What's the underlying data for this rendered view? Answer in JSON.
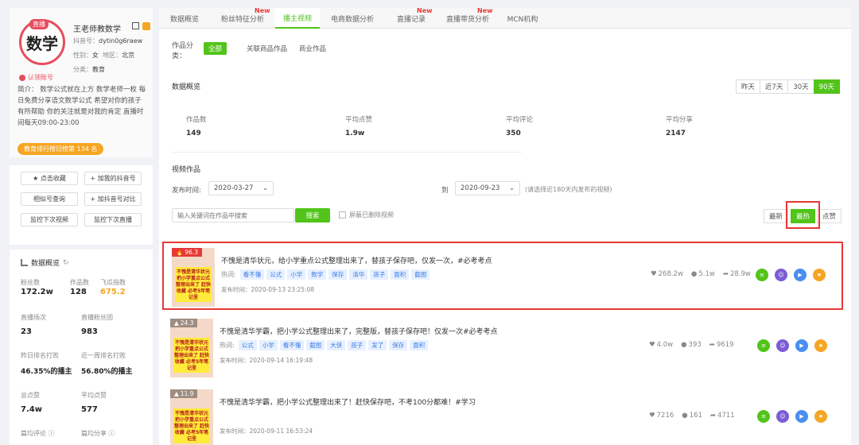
{
  "profile": {
    "live_tag": "直播",
    "avatar_text": "数学",
    "name": "王老师教数学",
    "douyin_id_label": "抖音号：",
    "douyin_id": "dytin0g6raew",
    "gender_label": "性别：",
    "gender": "女",
    "region_label": "地区：",
    "region": "北京",
    "category_label": "分类：",
    "category": "教育",
    "verified": "认领账号",
    "bio": "简介：  数学公式就在上方        数学老师一枚 每日免费分享语文数学公式 希望对你的孩子有所帮助 你的关注就是对我的肯定 直播时间每天09:00-23:00",
    "rank": "教育排行榜日榜第 134 名"
  },
  "actions": {
    "favorite": "★ 点击收藏",
    "add_my": "+ 加我的抖音号",
    "similar": "相似号查询",
    "compare": "+ 加抖音号对比",
    "monitor_video": "监控下次视频",
    "monitor_live": "监控下次直播"
  },
  "overview": {
    "title": "数据概览",
    "fans_lbl": "粉丝数",
    "fans": "172.2w",
    "works_lbl": "作品数",
    "works": "128",
    "flying_lbl": "飞瓜指数",
    "flying": "675.2",
    "live_cnt_lbl": "直播场次",
    "live_cnt": "23",
    "live_fans_lbl": "直播粉丝团",
    "live_fans": "983",
    "daily_rank_lbl": "昨日排名打败",
    "daily_rank": "46.35%的播主",
    "week_rank_lbl": "近一周排名打败",
    "week_rank": "56.80%的播主",
    "total_like_lbl": "总点赞",
    "total_like": "7.4w",
    "avg_like_lbl": "平均点赞",
    "avg_like": "577",
    "avg_comment_lbl": "篇均评论 ⓘ",
    "avg_share_lbl": "篇均分享 ⓘ"
  },
  "tabs": [
    {
      "label": "数据概览",
      "new": ""
    },
    {
      "label": "粉丝特征分析",
      "new": "New"
    },
    {
      "label": "播主视频",
      "new": ""
    },
    {
      "label": "电商数据分析",
      "new": ""
    },
    {
      "label": "直播记录",
      "new": "New"
    },
    {
      "label": "直播带货分析",
      "new": "New"
    },
    {
      "label": "MCN机构",
      "new": ""
    }
  ],
  "categories": {
    "label": "作品分类：",
    "items": [
      "全部",
      "关联商品作品",
      "商业作品"
    ]
  },
  "data_overview": {
    "title": "数据概览",
    "ranges": [
      "昨天",
      "近7天",
      "30天",
      "90天"
    ],
    "stats": [
      {
        "label": "作品数",
        "value": "149"
      },
      {
        "label": "平均点赞",
        "value": "1.9w"
      },
      {
        "label": "平均评论",
        "value": "350"
      },
      {
        "label": "平均分享",
        "value": "2147"
      }
    ]
  },
  "videos_section": {
    "title": "视频作品",
    "date_label": "发布时间:",
    "start": "2020-03-27",
    "to": "到",
    "end": "2020-09-23",
    "tip": "(请选择近180天内发布的视频)",
    "search_placeholder": "输入关键词在作品中搜索",
    "search_btn": "搜索",
    "hide_deleted": "屏蔽已删除视频",
    "sorts": [
      "最新",
      "最热",
      "点赞"
    ]
  },
  "videos": [
    {
      "score": "96.3",
      "title": "不愧是清华状元，给小学重点公式整理出来了，替孩子保存吧，仅发一次，#必考考点",
      "hot_label": "热词:",
      "tags": [
        "看不懂",
        "公式",
        "小学",
        "数学",
        "保存",
        "清华",
        "孩子",
        "面积",
        "截图"
      ],
      "time": "发布时间：2020-09-13 23:25:08",
      "likes": "268.2w",
      "comments": "5.1w",
      "shares": "28.9w",
      "thumb_text": "不愧是清华状元 把小学重点公式 整理出来了 赶快收藏 必考5年笔记里"
    },
    {
      "score": "24.3",
      "title": "不愧是清华学霸，把小学公式整理出来了，完整版，替孩子保存吧！仅发一次#必考考点",
      "hot_label": "热词:",
      "tags": [
        "公式",
        "小学",
        "看不懂",
        "截图",
        "大侠",
        "孩子",
        "发了",
        "保存",
        "面积"
      ],
      "time": "发布时间：2020-09-14 16:19:48",
      "likes": "4.0w",
      "comments": "393",
      "shares": "9619",
      "thumb_text": "不愧是清华状元 把小学重点公式 整理出来了 赶快收藏 必考5年笔记里"
    },
    {
      "score": "11.9",
      "title": "不愧是清华学霸，把小学公式整理出来了！赶快保存吧，不考100分都难！#学习",
      "hot_label": "",
      "tags": [],
      "time": "发布时间：2020-09-11 16:53:24",
      "likes": "7216",
      "comments": "161",
      "shares": "4711",
      "thumb_text": "不愧是清华状元 把小学重点公式 整理出来了 赶快收藏 必考5年笔记里"
    }
  ],
  "colors": {
    "accent": "#52c41a",
    "highlight": "#e53935",
    "orange": "#f5a623"
  }
}
